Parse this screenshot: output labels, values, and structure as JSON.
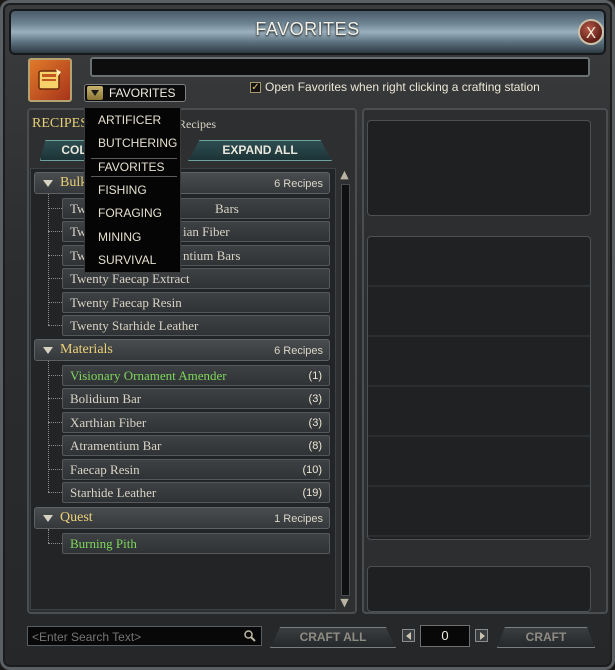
{
  "window": {
    "title": "FAVORITES",
    "close_label": "X"
  },
  "top": {
    "category_selected": "FAVORITES",
    "checkbox_mark": "✓",
    "checkbox_label": "Open Favorites when right clicking a crafting station"
  },
  "dropdown": {
    "options": [
      "ARTIFICER",
      "BUTCHERING",
      "FAVORITES",
      "FISHING",
      "FORAGING",
      "MINING",
      "SURVIVAL"
    ]
  },
  "left": {
    "header": "RECIPES",
    "header_suffix": "Recipes",
    "collapse_label": "COL",
    "expand_label": "EXPAND ALL"
  },
  "groups": [
    {
      "name": "Bulk",
      "count": "6 Recipes",
      "recipes": [
        {
          "name": "Twe",
          "tail": "Bars",
          "qty": ""
        },
        {
          "name": "Twe",
          "tail": "ian Fiber",
          "qty": ""
        },
        {
          "name": "Twe",
          "tail": "ntium Bars",
          "qty": ""
        },
        {
          "name": "Twenty Faecap Extract",
          "qty": ""
        },
        {
          "name": "Twenty Faecap Resin",
          "qty": ""
        },
        {
          "name": "Twenty Starhide Leather",
          "qty": ""
        }
      ]
    },
    {
      "name": "Materials",
      "count": "6 Recipes",
      "recipes": [
        {
          "name": "Visionary Ornament Amender",
          "qty": "(1)"
        },
        {
          "name": "Bolidium Bar",
          "qty": "(3)"
        },
        {
          "name": "Xarthian Fiber",
          "qty": "(3)"
        },
        {
          "name": "Atramentium Bar",
          "qty": "(8)"
        },
        {
          "name": "Faecap Resin",
          "qty": "(10)"
        },
        {
          "name": "Starhide Leather",
          "qty": "(19)"
        }
      ]
    },
    {
      "name": "Quest",
      "count": "1 Recipes",
      "recipes": [
        {
          "name": "Burning Pith",
          "qty": ""
        }
      ]
    }
  ],
  "bottom": {
    "search_placeholder": "<Enter Search Text>",
    "craft_all_label": "CRAFT ALL",
    "quantity": "0",
    "craft_label": "CRAFT"
  },
  "colors": {
    "accent_gold": "#e9cf77",
    "green_text": "#7ed75b"
  }
}
